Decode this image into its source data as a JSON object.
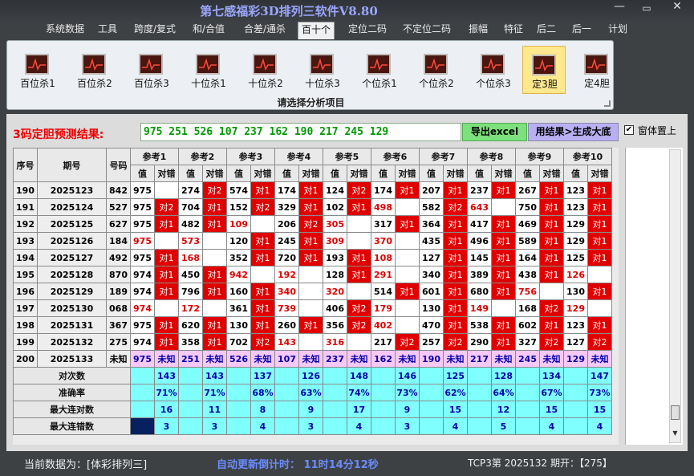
{
  "window": {
    "title": "第七感福彩3D排列三软件V8.80",
    "min": "—",
    "max": "▭",
    "close": "✕"
  },
  "menu": [
    "系统数据",
    "工具",
    "跨度/复式",
    "和/合值",
    "合差/通杀",
    "百十个",
    "定位二码",
    "不定位二码",
    "振幅",
    "特征",
    "后二",
    "后一",
    "计划"
  ],
  "menu_active": "百十个",
  "ribbon": {
    "items": [
      "百位杀1",
      "百位杀2",
      "百位杀3",
      "十位杀1",
      "十位杀2",
      "十位杀3",
      "个位杀1",
      "个位杀2",
      "个位杀3",
      "定3胆",
      "定4胆"
    ],
    "active": "定3胆",
    "caption": "请选择分析项目"
  },
  "prediction": {
    "label": "3码定胆预测结果:",
    "value": "975 251 526 107 237 162 190 217 245 129",
    "excel_button": "导出excel",
    "generate_button": "用结果>生成大底",
    "checkbox_label": "窗体置上",
    "checkbox_checked": true
  },
  "table": {
    "col_headers": {
      "index": "序号",
      "issue": "期号",
      "number": "号码",
      "value": "值",
      "hit": "对错"
    },
    "groups": [
      "参考1",
      "参考2",
      "参考3",
      "参考4",
      "参考5",
      "参考6",
      "参考7",
      "参考8",
      "参考9",
      "参考10"
    ],
    "rows": [
      {
        "idx": "190",
        "issue": "2025123",
        "num": "842",
        "cells": [
          [
            "975",
            0,
            ""
          ],
          [
            "274",
            0,
            "对2"
          ],
          [
            "574",
            0,
            "对1"
          ],
          [
            "174",
            0,
            "对1"
          ],
          [
            "124",
            0,
            "对2"
          ],
          [
            "174",
            0,
            "对1"
          ],
          [
            "207",
            0,
            "对1"
          ],
          [
            "237",
            0,
            "对1"
          ],
          [
            "267",
            0,
            "对1"
          ],
          [
            "123",
            0,
            "对1"
          ]
        ]
      },
      {
        "idx": "191",
        "issue": "2025124",
        "num": "527",
        "cells": [
          [
            "975",
            0,
            "对2"
          ],
          [
            "704",
            0,
            "对1"
          ],
          [
            "152",
            0,
            "对2"
          ],
          [
            "329",
            0,
            "对1"
          ],
          [
            "102",
            0,
            "对1"
          ],
          [
            "498",
            1,
            ""
          ],
          [
            "582",
            0,
            "对2"
          ],
          [
            "643",
            1,
            ""
          ],
          [
            "750",
            0,
            "对1"
          ],
          [
            "123",
            0,
            "对1"
          ]
        ]
      },
      {
        "idx": "192",
        "issue": "2025125",
        "num": "627",
        "cells": [
          [
            "975",
            0,
            "对1"
          ],
          [
            "482",
            0,
            "对1"
          ],
          [
            "109",
            1,
            ""
          ],
          [
            "206",
            0,
            "对2"
          ],
          [
            "305",
            1,
            ""
          ],
          [
            "317",
            0,
            "对1"
          ],
          [
            "364",
            0,
            "对1"
          ],
          [
            "417",
            0,
            "对1"
          ],
          [
            "469",
            0,
            "对1"
          ],
          [
            "129",
            0,
            "对1"
          ]
        ]
      },
      {
        "idx": "193",
        "issue": "2025126",
        "num": "184",
        "cells": [
          [
            "975",
            1,
            ""
          ],
          [
            "573",
            1,
            ""
          ],
          [
            "120",
            0,
            "对1"
          ],
          [
            "245",
            0,
            "对1"
          ],
          [
            "309",
            1,
            ""
          ],
          [
            "370",
            1,
            ""
          ],
          [
            "435",
            0,
            "对1"
          ],
          [
            "496",
            0,
            "对1"
          ],
          [
            "589",
            0,
            "对1"
          ],
          [
            "129",
            0,
            "对1"
          ]
        ]
      },
      {
        "idx": "194",
        "issue": "2025127",
        "num": "492",
        "cells": [
          [
            "975",
            0,
            "对1"
          ],
          [
            "168",
            1,
            ""
          ],
          [
            "352",
            0,
            "对1"
          ],
          [
            "720",
            0,
            "对1"
          ],
          [
            "193",
            0,
            "对1"
          ],
          [
            "108",
            1,
            ""
          ],
          [
            "127",
            0,
            "对1"
          ],
          [
            "145",
            0,
            "对1"
          ],
          [
            "164",
            0,
            "对1"
          ],
          [
            "125",
            0,
            "对1"
          ]
        ]
      },
      {
        "idx": "195",
        "issue": "2025128",
        "num": "870",
        "cells": [
          [
            "974",
            0,
            "对1"
          ],
          [
            "450",
            0,
            "对1"
          ],
          [
            "942",
            1,
            ""
          ],
          [
            "192",
            1,
            ""
          ],
          [
            "128",
            0,
            "对1"
          ],
          [
            "291",
            1,
            ""
          ],
          [
            "340",
            0,
            "对1"
          ],
          [
            "389",
            0,
            "对1"
          ],
          [
            "438",
            0,
            "对1"
          ],
          [
            "126",
            1,
            ""
          ]
        ]
      },
      {
        "idx": "196",
        "issue": "2025129",
        "num": "189",
        "cells": [
          [
            "974",
            0,
            "对1"
          ],
          [
            "796",
            0,
            "对1"
          ],
          [
            "160",
            0,
            "对1"
          ],
          [
            "340",
            1,
            ""
          ],
          [
            "320",
            1,
            ""
          ],
          [
            "514",
            0,
            "对1"
          ],
          [
            "601",
            0,
            "对1"
          ],
          [
            "680",
            0,
            "对1"
          ],
          [
            "756",
            1,
            ""
          ],
          [
            "130",
            0,
            "对1"
          ]
        ]
      },
      {
        "idx": "197",
        "issue": "2025130",
        "num": "068",
        "cells": [
          [
            "974",
            1,
            ""
          ],
          [
            "172",
            1,
            ""
          ],
          [
            "361",
            0,
            "对1"
          ],
          [
            "739",
            1,
            ""
          ],
          [
            "406",
            0,
            "对2"
          ],
          [
            "179",
            1,
            ""
          ],
          [
            "130",
            0,
            "对1"
          ],
          [
            "149",
            1,
            ""
          ],
          [
            "168",
            0,
            "对2"
          ],
          [
            "129",
            1,
            ""
          ]
        ]
      },
      {
        "idx": "198",
        "issue": "2025131",
        "num": "367",
        "cells": [
          [
            "975",
            0,
            "对1"
          ],
          [
            "620",
            0,
            "对1"
          ],
          [
            "130",
            0,
            "对1"
          ],
          [
            "260",
            0,
            "对1"
          ],
          [
            "356",
            0,
            "对2"
          ],
          [
            "402",
            1,
            ""
          ],
          [
            "470",
            0,
            "对1"
          ],
          [
            "538",
            0,
            "对1"
          ],
          [
            "602",
            0,
            "对1"
          ],
          [
            "123",
            0,
            "对1"
          ]
        ]
      },
      {
        "idx": "199",
        "issue": "2025132",
        "num": "275",
        "cells": [
          [
            "974",
            0,
            "对1"
          ],
          [
            "358",
            0,
            "对1"
          ],
          [
            "702",
            0,
            "对2"
          ],
          [
            "143",
            1,
            ""
          ],
          [
            "316",
            1,
            ""
          ],
          [
            "217",
            0,
            "对2"
          ],
          [
            "257",
            0,
            "对2"
          ],
          [
            "290",
            0,
            "对1"
          ],
          [
            "327",
            0,
            "对2"
          ],
          [
            "127",
            0,
            "对2"
          ]
        ]
      },
      {
        "idx": "200",
        "issue": "2025133",
        "num": "未知",
        "last": true,
        "cells": [
          [
            "975",
            0,
            "未知"
          ],
          [
            "251",
            0,
            "未知"
          ],
          [
            "526",
            0,
            "未知"
          ],
          [
            "107",
            0,
            "未知"
          ],
          [
            "237",
            0,
            "未知"
          ],
          [
            "162",
            0,
            "未知"
          ],
          [
            "190",
            0,
            "未知"
          ],
          [
            "217",
            0,
            "未知"
          ],
          [
            "245",
            0,
            "未知"
          ],
          [
            "129",
            0,
            "未知"
          ]
        ]
      }
    ],
    "stats": [
      {
        "label": "对次数",
        "values": [
          "143",
          "143",
          "137",
          "126",
          "148",
          "146",
          "125",
          "128",
          "134",
          "147"
        ]
      },
      {
        "label": "准确率",
        "values": [
          "71%",
          "71%",
          "68%",
          "63%",
          "74%",
          "73%",
          "62%",
          "64%",
          "67%",
          "73%"
        ]
      },
      {
        "label": "最大连对数",
        "values": [
          "16",
          "11",
          "8",
          "9",
          "17",
          "9",
          "15",
          "12",
          "15",
          "15"
        ]
      },
      {
        "label": "最大连错数",
        "values": [
          "3",
          "3",
          "4",
          "3",
          "4",
          "3",
          "4",
          "5",
          "4",
          "4"
        ]
      }
    ]
  },
  "status": {
    "data_source": "当前数据为：[体彩排列三]",
    "countdown": "自动更新倒计时： 11时14分12秒",
    "latest": "TCP3第 2025132 期开：【275】"
  }
}
